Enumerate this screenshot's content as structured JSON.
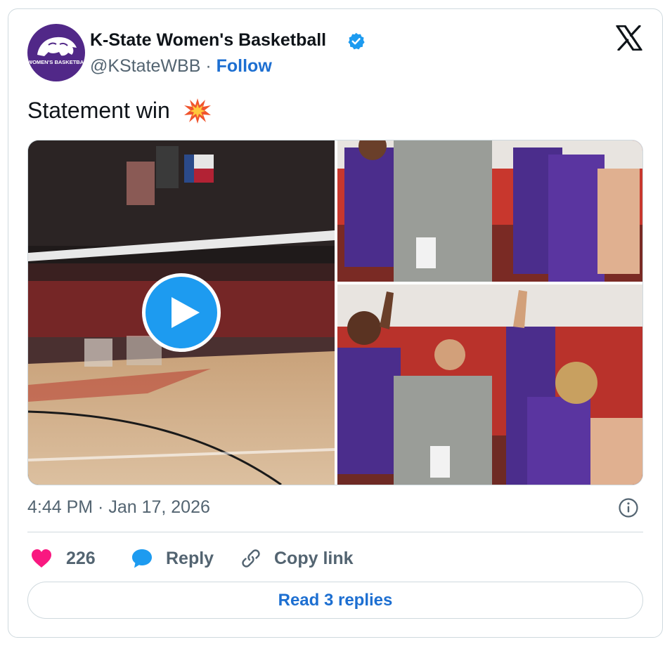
{
  "account": {
    "name": "K-State Women's Basketball",
    "handle": "@KStateWBB",
    "separator": "·",
    "follow_label": "Follow",
    "avatar_text": "WOMEN'S BASKETBALL",
    "avatar_color": "#512888",
    "verified": true,
    "verified_icon": "verified-badge-icon"
  },
  "tweet": {
    "text": "Statement win",
    "emoji_icon": "collision-burst-icon"
  },
  "media": {
    "video_icon": "play-icon",
    "photo_count": 2
  },
  "meta": {
    "timestamp": "4:44 PM · Jan 17, 2026",
    "info_icon": "info-icon"
  },
  "actions": {
    "like_count": "226",
    "like_icon": "heart-icon",
    "reply_label": "Reply",
    "reply_icon": "speech-bubble-icon",
    "copy_label": "Copy link",
    "copy_icon": "link-icon"
  },
  "read_replies_label": "Read 3 replies",
  "colors": {
    "accent": "#1d6fd1",
    "like": "#f91880",
    "muted": "#536471",
    "border": "#cfd9de",
    "team_purple": "#512888"
  }
}
